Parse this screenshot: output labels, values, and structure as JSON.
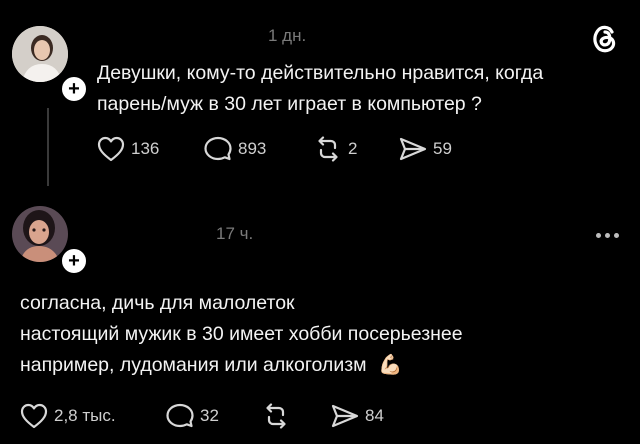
{
  "post": {
    "time": "1 дн.",
    "text_lines": [
      "Девушки, кому-то действительно нравится, когда",
      "парень/муж в 30 лет играет в компьютер ?"
    ],
    "likes": "136",
    "replies": "893",
    "reposts": "2",
    "shares": "59"
  },
  "reply": {
    "time": "17 ч.",
    "text_lines": [
      "согласна, дичь для малолеток",
      "настоящий мужик в 30 имеет хобби посерьезнее",
      "например, лудомания или алкоголизм"
    ],
    "emoji": "💪🏻",
    "likes": "2,8 тыс.",
    "replies": "32",
    "shares": "84"
  },
  "icons": {
    "brand": "threads-logo-icon",
    "like": "heart-icon",
    "reply": "comment-bubble-icon",
    "repost": "repost-arrows-icon",
    "share": "send-icon",
    "more": "more-dots-icon",
    "follow": "plus-icon"
  }
}
